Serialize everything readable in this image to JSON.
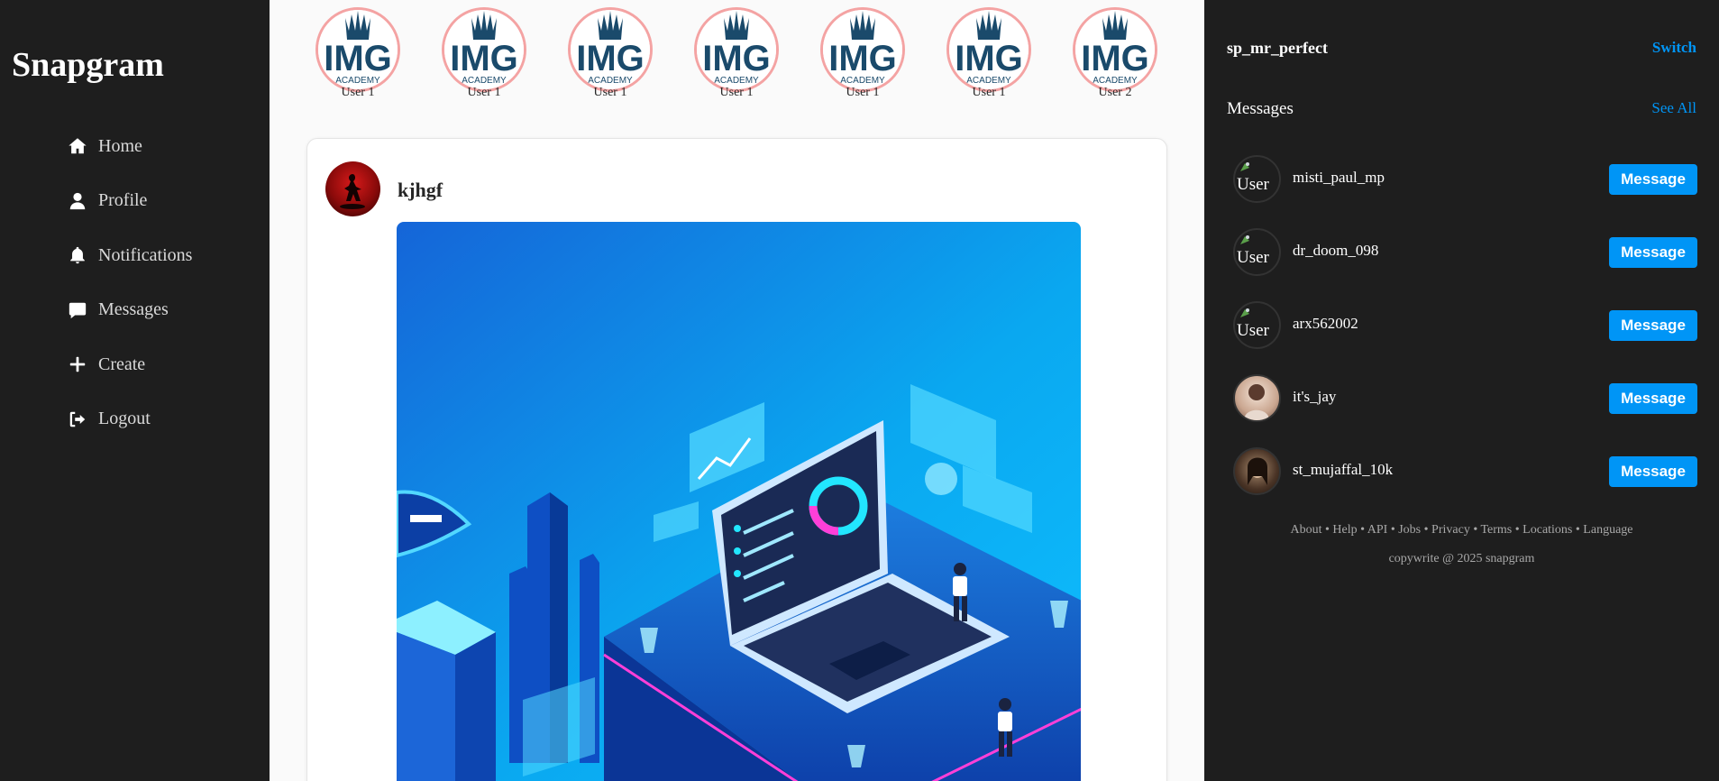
{
  "brand": "Snapgram",
  "nav": [
    {
      "label": "Home",
      "icon": "home-icon"
    },
    {
      "label": "Profile",
      "icon": "user-icon"
    },
    {
      "label": "Notifications",
      "icon": "bell-icon"
    },
    {
      "label": "Messages",
      "icon": "chat-icon"
    },
    {
      "label": "Create",
      "icon": "plus-icon"
    },
    {
      "label": "Logout",
      "icon": "logout-icon"
    }
  ],
  "stories": [
    {
      "name": "User 1",
      "logo_text": "IMG",
      "logo_sub": "ACADEMY"
    },
    {
      "name": "User 1",
      "logo_text": "IMG",
      "logo_sub": "ACADEMY"
    },
    {
      "name": "User 1",
      "logo_text": "IMG",
      "logo_sub": "ACADEMY"
    },
    {
      "name": "User 1",
      "logo_text": "IMG",
      "logo_sub": "ACADEMY"
    },
    {
      "name": "User 1",
      "logo_text": "IMG",
      "logo_sub": "ACADEMY"
    },
    {
      "name": "User 1",
      "logo_text": "IMG",
      "logo_sub": "ACADEMY"
    },
    {
      "name": "User 2",
      "logo_text": "IMG",
      "logo_sub": "ACADEMY"
    }
  ],
  "post": {
    "username": "kjhgf",
    "image": "laptop-analytics-illustration"
  },
  "right": {
    "current_user": "sp_mr_perfect",
    "switch_label": "Switch",
    "messages_title": "Messages",
    "see_all_label": "See All",
    "contacts": [
      {
        "username": "misti_paul_mp",
        "avatar_alt": "User",
        "button": "Message"
      },
      {
        "username": "dr_doom_098",
        "avatar_alt": "User",
        "button": "Message"
      },
      {
        "username": "arx562002",
        "avatar_alt": "User",
        "button": "Message"
      },
      {
        "username": "it's_jay",
        "avatar_alt": "",
        "button": "Message"
      },
      {
        "username": "st_mujaffal_10k",
        "avatar_alt": "",
        "button": "Message"
      }
    ],
    "footer_links": [
      "About",
      "Help",
      "API",
      "Jobs",
      "Privacy",
      "Terms",
      "Locations",
      "Language"
    ],
    "footer_separator": "•",
    "copyright": "copywrite @ 2025 snapgram"
  },
  "colors": {
    "accent": "#0095f6",
    "sidebar_bg": "#1e1e1e",
    "feed_bg": "#fafafa",
    "story_ring": "#f4a3a3",
    "logo_navy": "#1a4a6b"
  }
}
